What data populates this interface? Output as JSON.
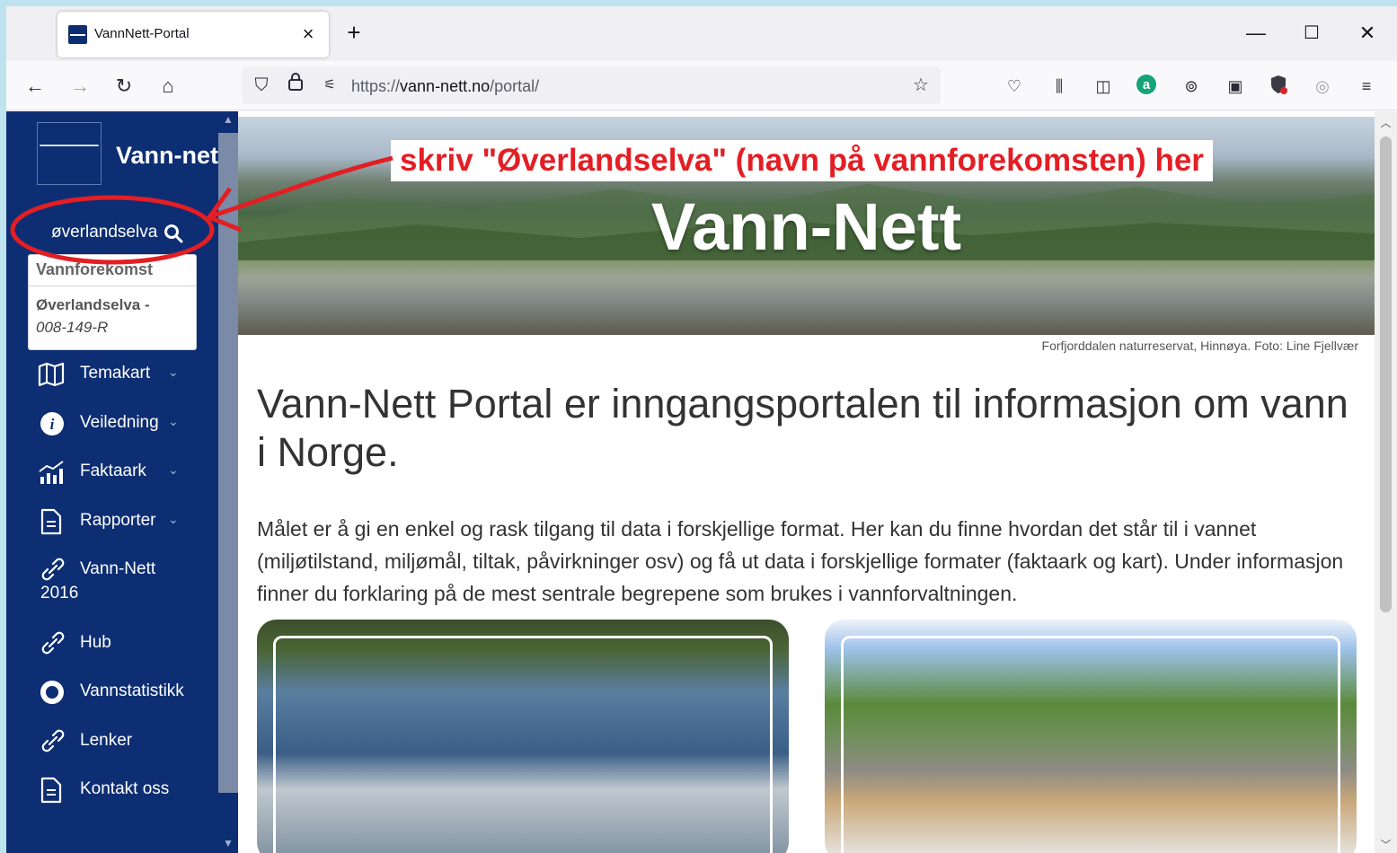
{
  "browser": {
    "tab_title": "VannNett-Portal",
    "tab_close": "×",
    "new_tab": "+",
    "window_controls": {
      "minimize": "—",
      "maximize": "☐",
      "close": "✕"
    },
    "url_prefix": "https://",
    "url_domain": "vann-nett.no",
    "url_path": "/portal/"
  },
  "sidebar": {
    "logo_text": "Vann-net",
    "search": {
      "value": "øverlandselva"
    },
    "dropdown": {
      "header": "Vannforekomst",
      "item_name": "Øverlandselva -",
      "item_id": "008-149-R"
    },
    "items": [
      {
        "label": "Temakart",
        "icon": "map-icon",
        "chevron": "⌄"
      },
      {
        "label": "Veiledning",
        "icon": "info-icon",
        "chevron": "⌄"
      },
      {
        "label": "Faktaark",
        "icon": "chart-icon",
        "chevron": "⌄"
      },
      {
        "label": "Rapporter",
        "icon": "document-icon",
        "chevron": "⌄"
      },
      {
        "label": "Vann-Nett",
        "label2": "2016",
        "icon": "link-icon"
      },
      {
        "label": "Hub",
        "icon": "link-icon"
      },
      {
        "label": "Vannstatistikk",
        "icon": "circle-icon"
      },
      {
        "label": "Lenker",
        "icon": "link-icon"
      },
      {
        "label": "Kontakt oss",
        "icon": "document-icon"
      }
    ]
  },
  "hero": {
    "title": "Vann-Nett",
    "credit": "Forfjorddalen naturreservat, Hinnøya. Foto: Line Fjellvær"
  },
  "annotation": {
    "text": "skriv \"Øverlandselva\" (navn på vannforekomsten) her",
    "color": "#e31e24"
  },
  "main": {
    "heading": "Vann-Nett Portal er inngangsportalen til informasjon om vann i Norge.",
    "paragraph": "Målet er å gi en enkel og rask tilgang til data i forskjellige format. Her kan du finne hvordan det står til i vannet (miljøtilstand, miljømål, tiltak, påvirkninger osv) og få ut data i forskjellige formater (faktaark og kart). Under informasjon finner du forklaring på de mest sentrale begrepene som brukes i vannforvaltningen."
  },
  "colors": {
    "sidebar_bg": "#0d2e73",
    "accent_red": "#e31e24"
  }
}
